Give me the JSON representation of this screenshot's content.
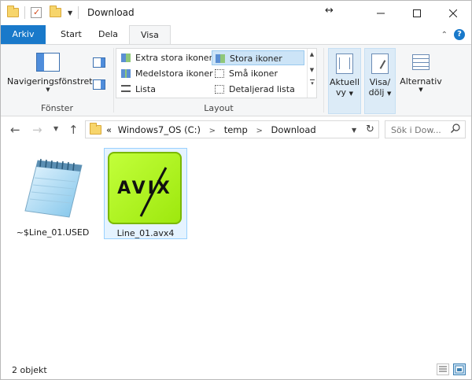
{
  "window": {
    "title": "Download"
  },
  "ribbon_tabs": [
    {
      "label": "Arkiv"
    },
    {
      "label": "Start"
    },
    {
      "label": "Dela"
    },
    {
      "label": "Visa"
    }
  ],
  "ribbon": {
    "navpane": {
      "label": "Navigeringsfönstret",
      "group": "Fönster"
    },
    "layout": {
      "group": "Layout",
      "items": [
        {
          "label": "Extra stora ikoner",
          "selected": false
        },
        {
          "label": "Stora ikoner",
          "selected": true
        },
        {
          "label": "Medelstora ikoner",
          "selected": false
        },
        {
          "label": "Små ikoner",
          "selected": false
        },
        {
          "label": "Lista",
          "selected": false
        },
        {
          "label": "Detaljerad lista",
          "selected": false
        }
      ]
    },
    "current_view": {
      "line1": "Aktuell",
      "line2": "vy"
    },
    "show_hide": {
      "line1": "Visa/",
      "line2": "dölj"
    },
    "options": {
      "label": "Alternativ"
    }
  },
  "address_bar": {
    "prefix": "«",
    "crumbs": [
      "Windows7_OS (C:)",
      "temp",
      "Download"
    ]
  },
  "search": {
    "placeholder": "Sök i Dow..."
  },
  "files": [
    {
      "name": "~$Line_01.USED",
      "icon": "notepad-icon",
      "selected": false
    },
    {
      "name": "Line_01.avx4",
      "icon": "avix-icon",
      "selected": true,
      "badge_text": "AVIX"
    }
  ],
  "status": {
    "count": "2 objekt"
  },
  "colors": {
    "accent": "#1979ca",
    "selection": "#cce4f7",
    "avix_green": "#9ee80e"
  }
}
